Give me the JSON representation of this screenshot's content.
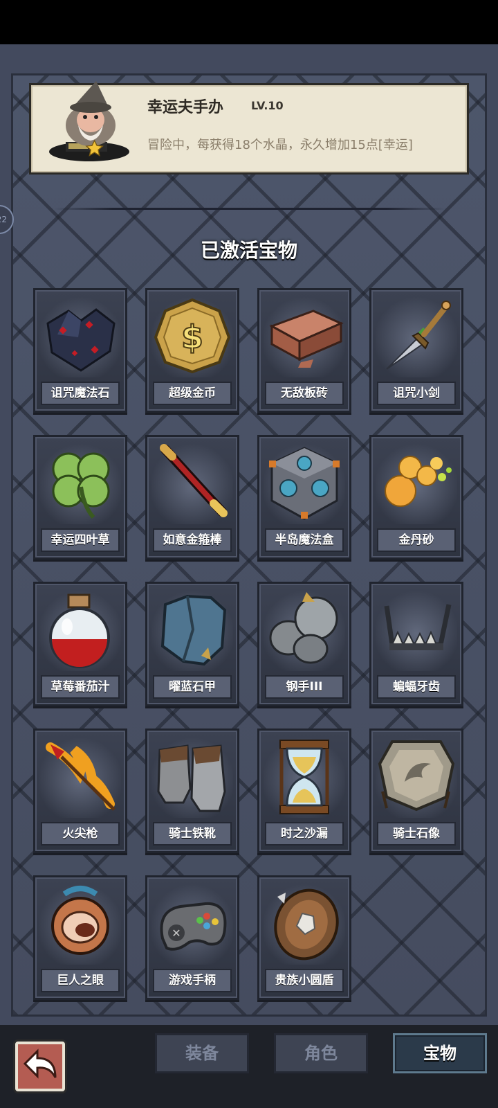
{
  "hero": {
    "name": "幸运夫手办",
    "level": "LV.10",
    "description": "冒险中，每获得18个水晶，永久增加15点[幸运]"
  },
  "side_badge": "22",
  "section_title": "已激活宝物",
  "treasures": [
    {
      "name": "诅咒魔法石",
      "icon": "cursed-stone-icon"
    },
    {
      "name": "超级金币",
      "icon": "gold-coin-icon"
    },
    {
      "name": "无敌板砖",
      "icon": "brick-icon"
    },
    {
      "name": "诅咒小剑",
      "icon": "dagger-icon"
    },
    {
      "name": "幸运四叶草",
      "icon": "clover-icon"
    },
    {
      "name": "如意金箍棒",
      "icon": "staff-icon"
    },
    {
      "name": "半岛魔法盒",
      "icon": "magic-cube-icon"
    },
    {
      "name": "金丹砂",
      "icon": "golden-pills-icon"
    },
    {
      "name": "草莓番茄汁",
      "icon": "potion-icon"
    },
    {
      "name": "曜蓝石甲",
      "icon": "blue-armor-icon"
    },
    {
      "name": "钢手III",
      "icon": "steel-gauntlet-icon"
    },
    {
      "name": "蝙蝠牙齿",
      "icon": "bat-teeth-icon"
    },
    {
      "name": "火尖枪",
      "icon": "fire-spear-icon"
    },
    {
      "name": "骑士铁靴",
      "icon": "iron-boots-icon"
    },
    {
      "name": "时之沙漏",
      "icon": "hourglass-icon"
    },
    {
      "name": "骑士石像",
      "icon": "stone-tablet-icon"
    },
    {
      "name": "巨人之眼",
      "icon": "giant-eye-icon"
    },
    {
      "name": "游戏手柄",
      "icon": "gamepad-icon"
    },
    {
      "name": "贵族小圆盾",
      "icon": "round-shield-icon"
    }
  ],
  "tabs": [
    {
      "label": "装备",
      "active": false
    },
    {
      "label": "角色",
      "active": false
    },
    {
      "label": "宝物",
      "active": true
    }
  ]
}
